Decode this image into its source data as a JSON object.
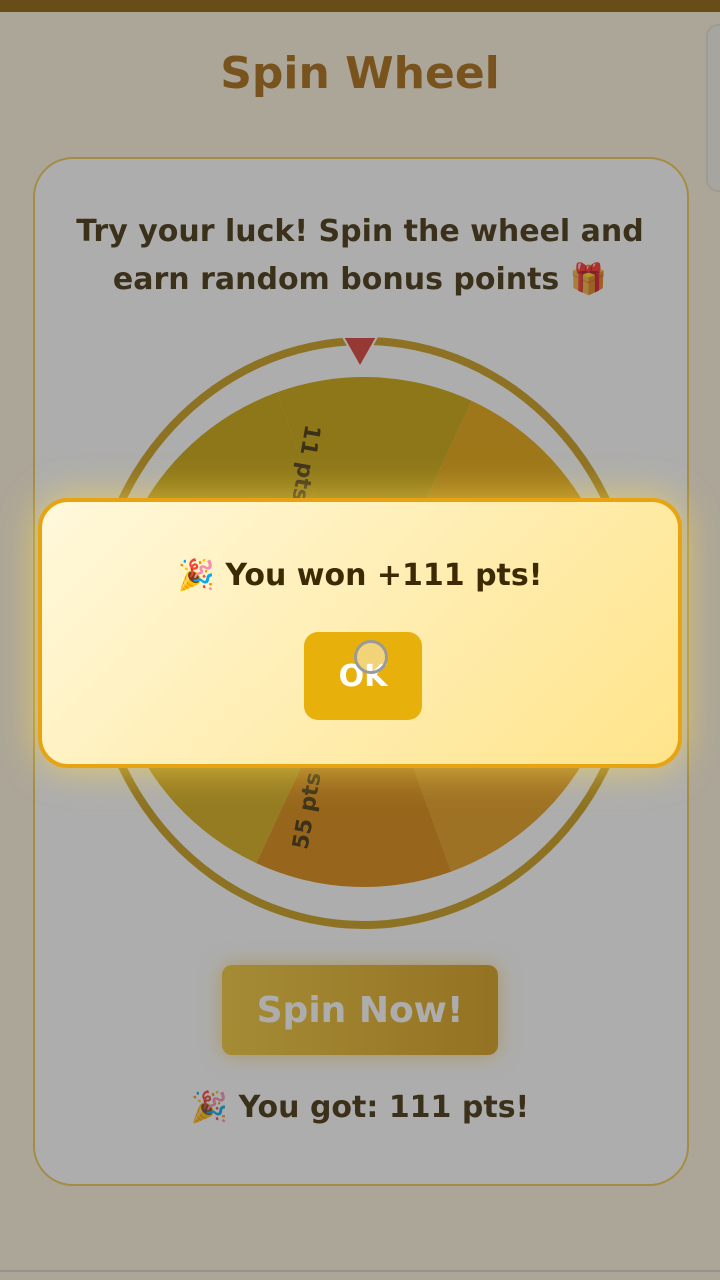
{
  "header": {
    "title": "Spin Wheel"
  },
  "card": {
    "description": "Try your luck! Spin the wheel and earn random bonus points 🎁",
    "spin_label": "Spin Now!",
    "result_text": "🎉 You got: 111 pts!"
  },
  "wheel": {
    "visible_labels": [
      "11 pts",
      "55 pts"
    ],
    "colors": [
      "#c9a200",
      "#e3a300",
      "#e8ad10",
      "#e59a14",
      "#d98506",
      "#d6aa10",
      "#cc8f0a",
      "#c9a200"
    ]
  },
  "modal": {
    "message": "🎉 You won +111 pts!",
    "ok_label": "OK"
  },
  "colors": {
    "brand": "#a5650a",
    "accent": "#e8b00a",
    "pointer": "#d8362e"
  }
}
